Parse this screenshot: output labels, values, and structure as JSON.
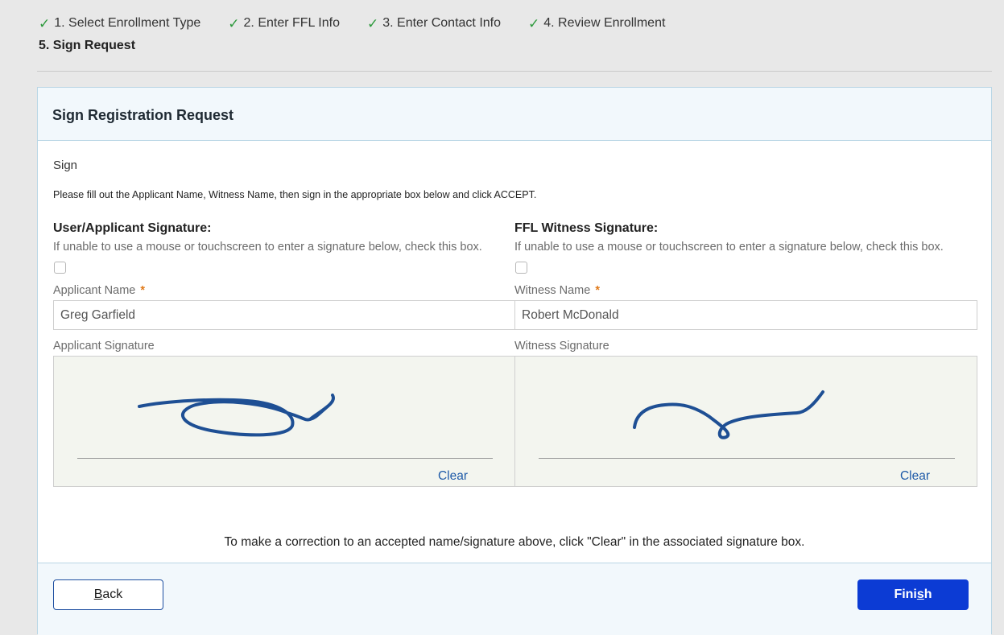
{
  "steps": {
    "completed": [
      {
        "label": "1. Select Enrollment Type"
      },
      {
        "label": "2. Enter FFL Info"
      },
      {
        "label": "3. Enter Contact Info"
      },
      {
        "label": "4. Review Enrollment"
      }
    ],
    "current": "5. Sign Request",
    "check_icon": "checkmark-icon"
  },
  "card": {
    "title": "Sign Registration Request",
    "section": "Sign",
    "instructions": "Please fill out the Applicant Name, Witness Name, then sign in the appropriate box below and click ACCEPT.",
    "applicant": {
      "title": "User/Applicant Signature:",
      "hint": "If unable to use a mouse or touchscreen to enter a signature below, check this box.",
      "checkbox_checked": false,
      "name_label": "Applicant Name",
      "required_mark": "*",
      "name_value": "Greg Garfield",
      "signature_label": "Applicant Signature",
      "clear_label": "Clear"
    },
    "witness": {
      "title": "FFL Witness Signature:",
      "hint": "If unable to use a mouse or touchscreen to enter a signature below, check this box.",
      "checkbox_checked": false,
      "name_label": "Witness Name",
      "required_mark": "*",
      "name_value": "Robert McDonald",
      "signature_label": "Witness Signature",
      "clear_label": "Clear"
    },
    "correction_note": "To make a correction to an accepted name/signature above, click \"Clear\" in the associated signature box."
  },
  "footer": {
    "back_label_accel": "B",
    "back_label_rest": "ack",
    "finish_label_pre": "Fini",
    "finish_label_accel": "s",
    "finish_label_post": "h"
  },
  "colors": {
    "accent": "#0c3bd4",
    "check": "#2e9a3d",
    "required": "#e07a1a",
    "link": "#1e5aa8",
    "ink": "#1e4f94"
  }
}
